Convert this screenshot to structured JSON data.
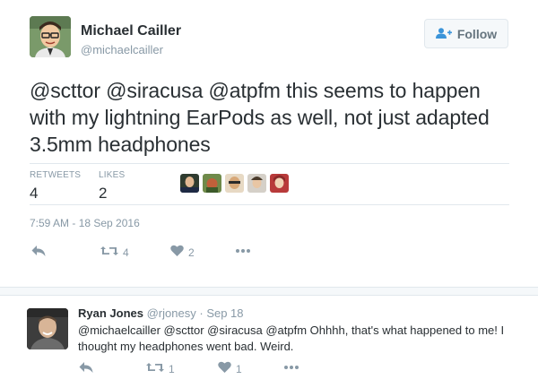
{
  "tweet": {
    "display_name": "Michael Cailler",
    "handle": "@michaelcailler",
    "follow_label": "Follow",
    "text": "@scttor @siracusa @atpfm this seems to happen with my lightning EarPods as well, not just adapted 3.5mm headphones",
    "retweets_label": "RETWEETS",
    "retweets_count": "4",
    "likes_label": "LIKES",
    "likes_count": "2",
    "timestamp": "7:59 AM - 18 Sep 2016",
    "actions": {
      "reply_icon": "reply-icon",
      "retweet_icon": "retweet-icon",
      "retweet_count": "4",
      "like_icon": "heart-icon",
      "like_count": "2",
      "more_icon": "more-icon"
    },
    "liker_colors": [
      "#3a4a3a",
      "#9a6a3a",
      "#c8a070",
      "#6a5a48",
      "#a04040"
    ]
  },
  "reply": {
    "display_name": "Ryan Jones",
    "handle": "@rjonesy",
    "separator": "·",
    "date": "Sep 18",
    "text": "@michaelcailler @scttor @siracusa @atpfm Ohhhh, that's what happened to me! I thought my headphones went bad. Weird.",
    "actions": {
      "retweet_count": "1",
      "like_count": "1"
    }
  },
  "colors": {
    "text": "#292f33",
    "muted": "#8899a6",
    "border": "#e1e8ed",
    "action_icon": "#8899a6"
  }
}
